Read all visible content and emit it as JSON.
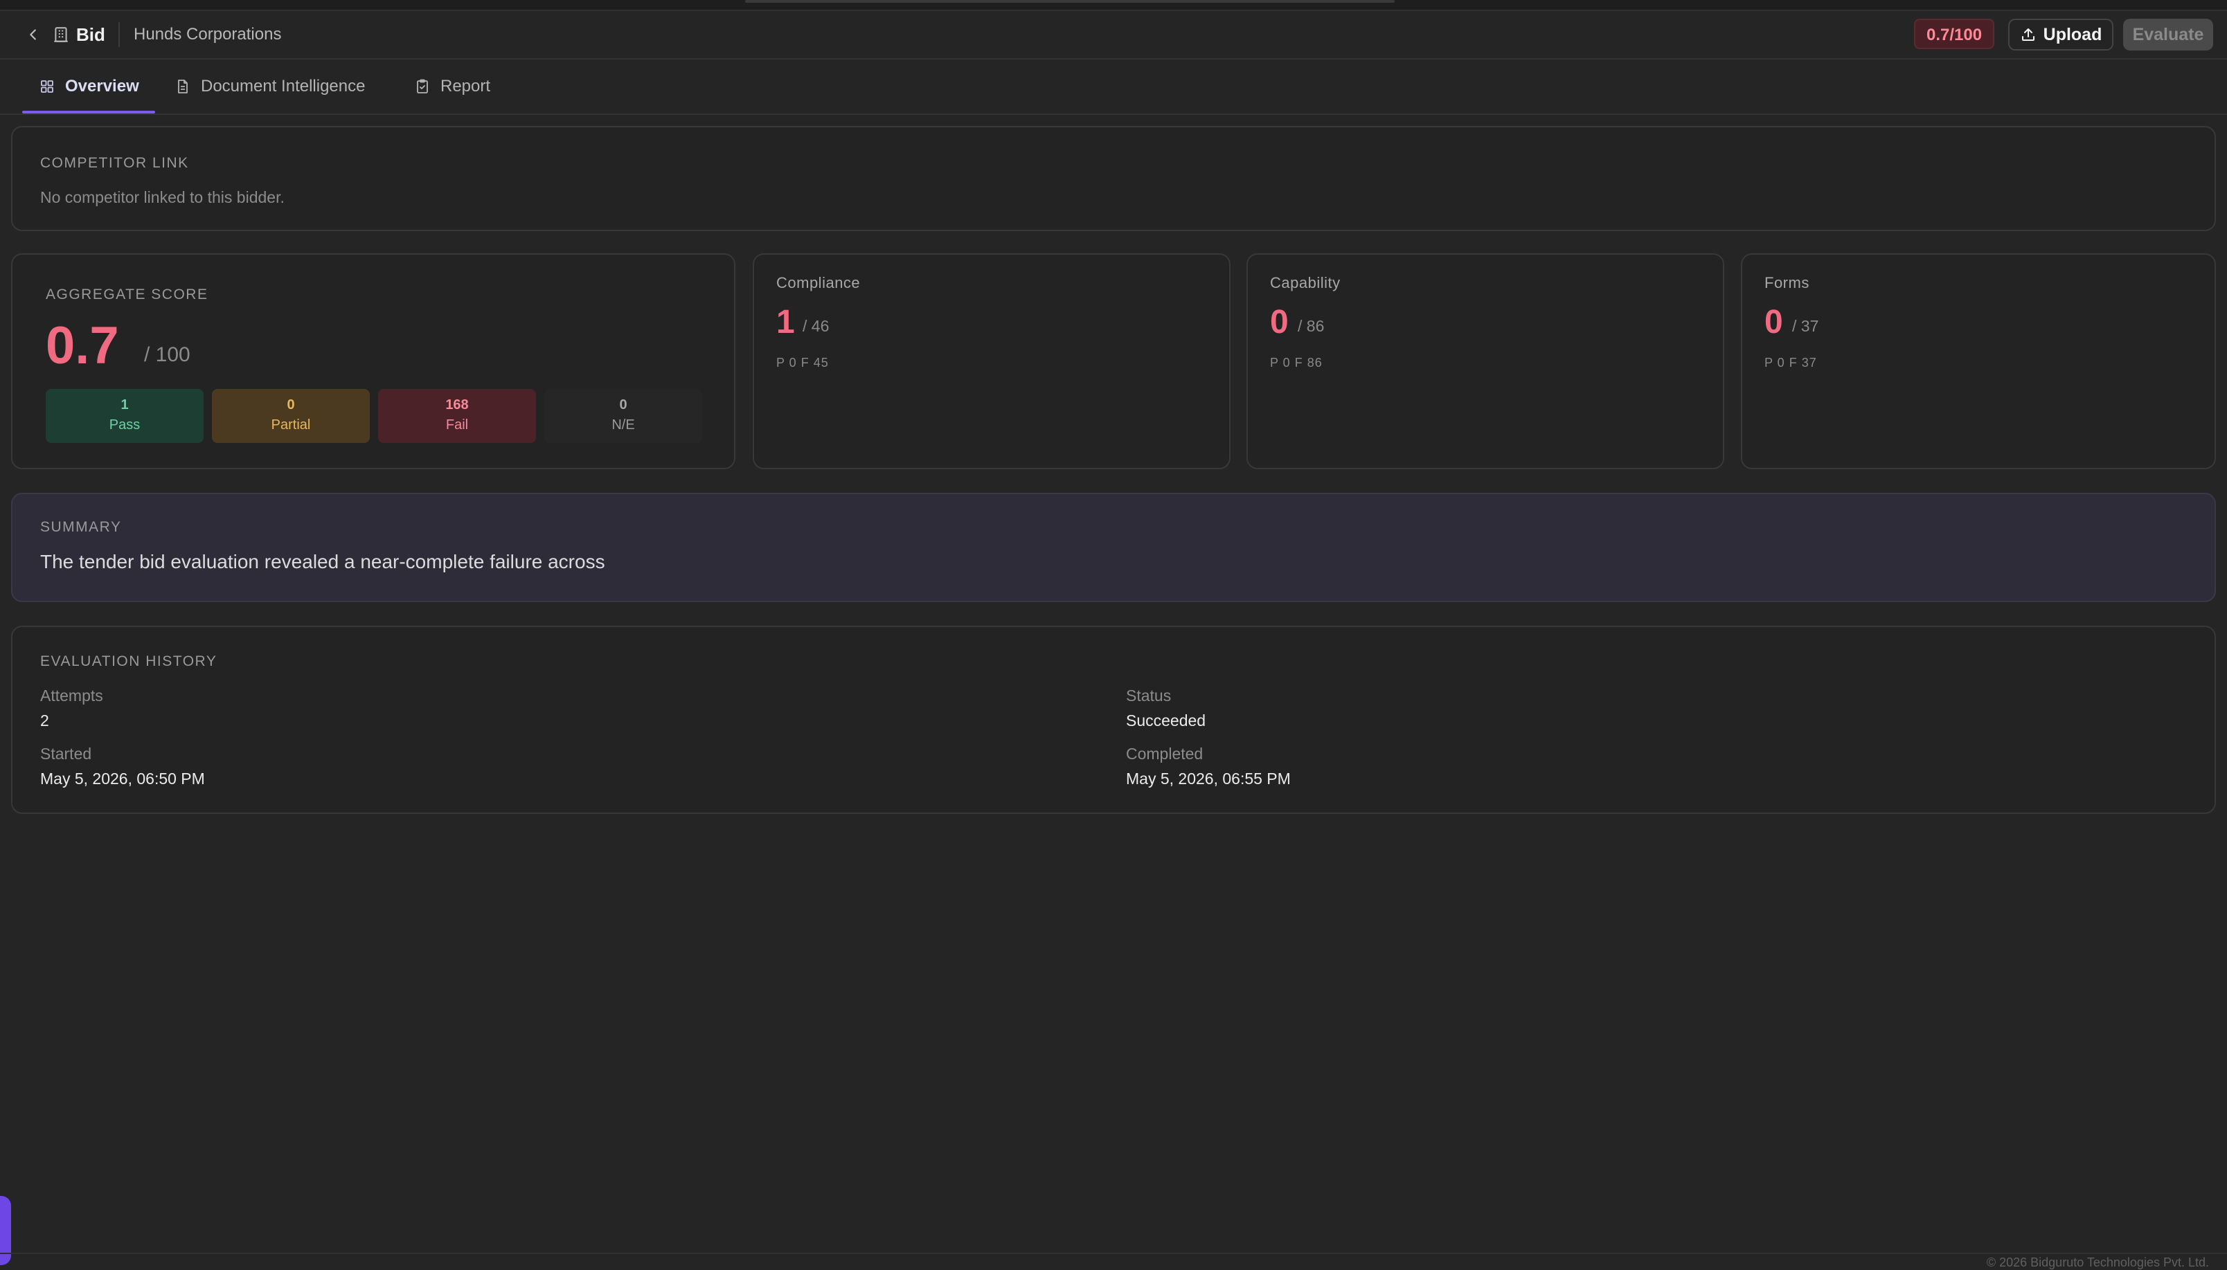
{
  "header": {
    "back_icon": "chevron-left-icon",
    "bid_icon": "building-icon",
    "bid_label": "Bid",
    "company": "Hunds Corporations",
    "score_badge": "0.7/100",
    "upload_label": "Upload",
    "upload_icon": "upload-icon",
    "evaluate_label": "Evaluate"
  },
  "tabs": [
    {
      "label": "Overview",
      "icon": "grid-icon",
      "active": true
    },
    {
      "label": "Document Intelligence",
      "icon": "document-icon",
      "active": false
    },
    {
      "label": "Report",
      "icon": "clipboard-check-icon",
      "active": false
    }
  ],
  "competitor": {
    "title": "COMPETITOR LINK",
    "text": "No competitor linked to this bidder."
  },
  "aggregate": {
    "title": "AGGREGATE SCORE",
    "score": "0.7",
    "max": "/ 100",
    "pills": [
      {
        "count": "1",
        "label": "Pass",
        "bg": "#1d3f33",
        "fg": "#6fd0a4"
      },
      {
        "count": "0",
        "label": "Partial",
        "bg": "#4b3a1f",
        "fg": "#e8b75a"
      },
      {
        "count": "168",
        "label": "Fail",
        "bg": "#4c2229",
        "fg": "#f58a98"
      },
      {
        "count": "0",
        "label": "N/E",
        "bg": "#262626",
        "fg": "#9a9a9a"
      }
    ]
  },
  "categories": [
    {
      "title": "Compliance",
      "value": "1",
      "max": "/ 46",
      "pf": "P 0   F 45"
    },
    {
      "title": "Capability",
      "value": "0",
      "max": "/ 86",
      "pf": "P 0   F 86"
    },
    {
      "title": "Forms",
      "value": "0",
      "max": "/ 37",
      "pf": "P 0   F 37"
    }
  ],
  "summary": {
    "title": "SUMMARY",
    "text": "The tender bid evaluation revealed a near-complete failure across"
  },
  "history": {
    "title": "EVALUATION HISTORY",
    "attempts_label": "Attempts",
    "attempts_value": "2",
    "status_label": "Status",
    "status_value": "Succeeded",
    "started_label": "Started",
    "started_value": "May 5, 2026, 06:50 PM",
    "completed_label": "Completed",
    "completed_value": "May 5, 2026, 06:55 PM"
  },
  "footer": {
    "copyright": "© 2026 Bidguruto Technologies Pvt. Ltd."
  },
  "colors": {
    "accent": "#7c5cf0",
    "score_red": "#f06b82",
    "background": "#252525"
  }
}
